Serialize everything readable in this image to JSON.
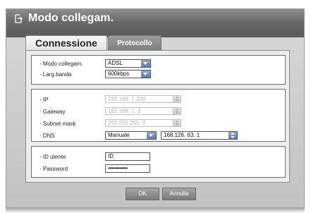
{
  "window": {
    "title": "Modo collegam.",
    "title_icon": "network-icon"
  },
  "tabs": [
    {
      "label": "Connessione",
      "active": true
    },
    {
      "label": "Protocollo",
      "active": false
    }
  ],
  "connection": {
    "mode_label": "· Modo collegam.",
    "mode_value": "ADSL",
    "bandwidth_label": "· Larg.banda",
    "bandwidth_value": "600kbps"
  },
  "network": {
    "ip_label": "· IP",
    "ip_value": "192.168.  1.200",
    "gateway_label": "· Gateway",
    "gateway_value": "192.168.  1.   1",
    "subnet_label": "· Subnet mask",
    "subnet_value": "255.255.255.  0",
    "dns_label": "· DNS",
    "dns_mode": "Manuale",
    "dns_value": "168.126.  63.   1"
  },
  "account": {
    "user_label": "· ID utente",
    "user_value": "ID",
    "password_label": "· Password",
    "password_value": "••••••••••••"
  },
  "buttons": {
    "ok": "OK",
    "cancel": "Annulla"
  },
  "colors": {
    "title_bar": "#6a6a6a",
    "dropdown_arrow": "#5d7db0"
  }
}
